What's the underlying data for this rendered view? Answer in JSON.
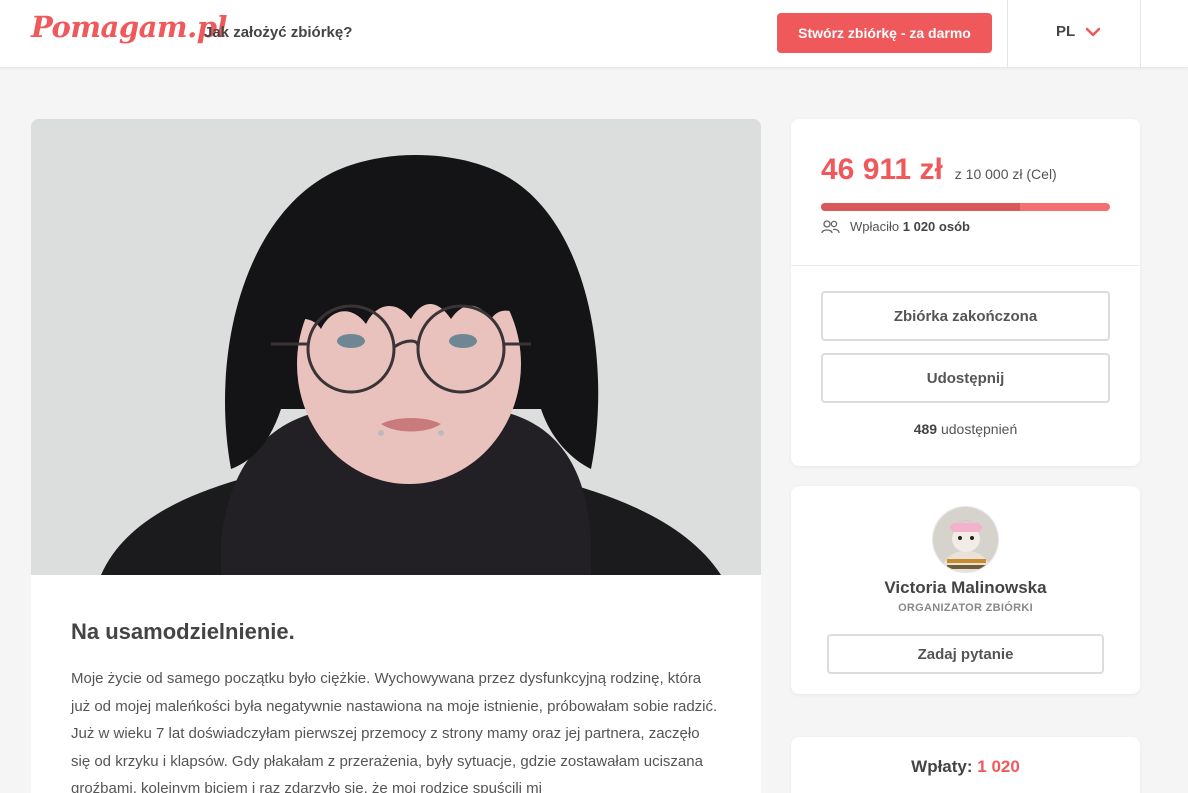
{
  "header": {
    "logo": "Pomagam.pl",
    "how_to_label": "Jak założyć zbiórkę?",
    "cta_label": "Stwórz zbiórkę - za darmo",
    "language": "PL"
  },
  "campaign": {
    "title": "Na usamodzielnienie.",
    "description": "Moje życie od samego początku było ciężkie. Wychowywana przez dysfunkcyjną rodzinę, która już od mojej maleńkości była negatywnie nastawiona na moje istnienie, próbowałam sobie radzić. Już w wieku 7 lat doświadczyłam pierwszej przemocy z strony mamy oraz jej partnera, zaczęło się od krzyku i klapsów. Gdy płakałam z przerażenia, były sytuacje, gdzie zostawałam uciszana groźbami, kolejnym biciem i raz zdarzyło się, że moi rodzice spuścili mi"
  },
  "funding": {
    "amount": "46 911 zł",
    "goal": "z 10 000 zł (Cel)",
    "progress_fraction": 0.69,
    "donors_prefix": "Wpłaciło",
    "donors_count": "1 020 osób",
    "ended_label": "Zbiórka zakończona",
    "share_label": "Udostępnij",
    "shares_count": "489",
    "shares_suffix": "udostępnień"
  },
  "organizer": {
    "name": "Victoria Malinowska",
    "role": "ORGANIZATOR ZBIÓRKI",
    "ask_label": "Zadaj pytanie"
  },
  "payments": {
    "label": "Wpłaty:",
    "count": "1 020"
  },
  "colors": {
    "accent": "#f0595c",
    "page_bg": "#f5f5f5"
  }
}
